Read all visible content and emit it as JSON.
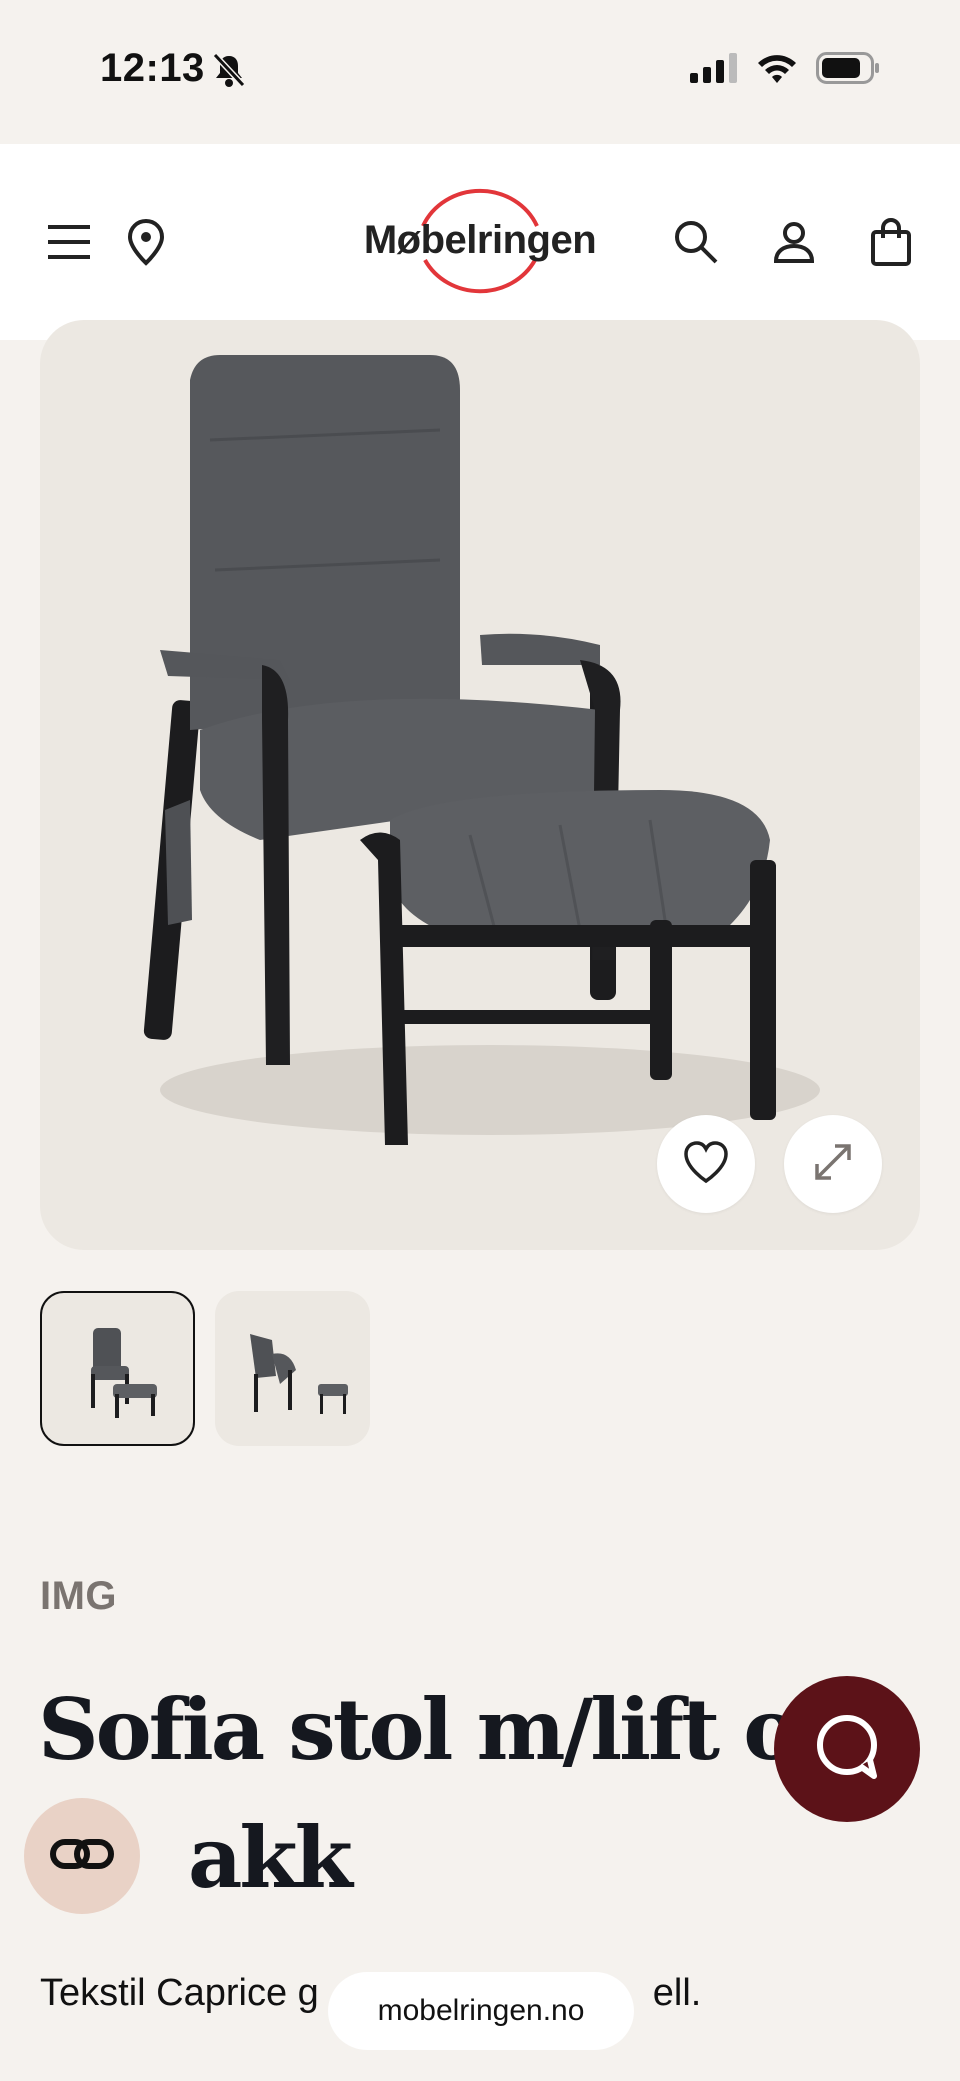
{
  "status_bar": {
    "time": "12:13"
  },
  "header": {
    "logo_text": "Møbelringen",
    "logo_color": "#e2363a"
  },
  "product": {
    "brand": "IMG",
    "title_line1": "Sofia stol m/lift og",
    "title_line2": "akk",
    "subtitle": "Tekstil Caprice g",
    "subtitle_tail": "ell."
  },
  "browser": {
    "url": "mobelringen.no"
  },
  "colors": {
    "chat_fab": "#5c1218",
    "bubble_fab": "#e9d2c6",
    "background": "#f5f2ee"
  },
  "icons": [
    "bell-slash-icon",
    "signal-icon",
    "wifi-icon",
    "battery-icon",
    "menu-icon",
    "location-pin-icon",
    "search-icon",
    "user-icon",
    "shopping-bag-icon",
    "heart-icon",
    "expand-icon",
    "chat-icon",
    "link-icon"
  ]
}
